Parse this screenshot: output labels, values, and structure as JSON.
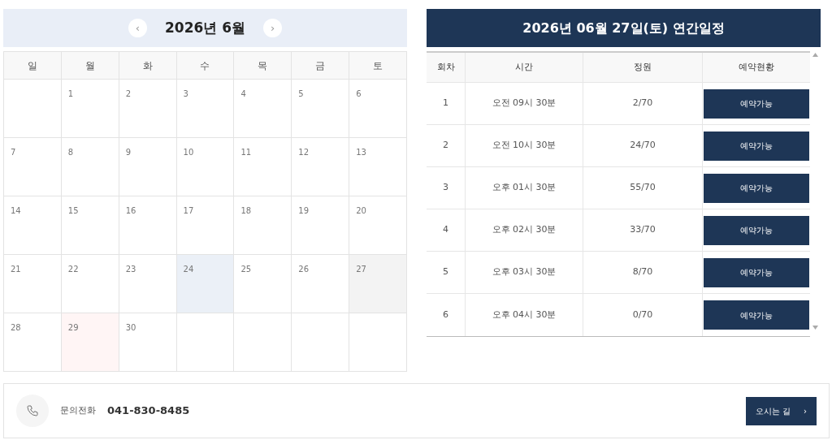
{
  "calendar": {
    "title": "2026년 6월",
    "prev": "‹",
    "next": "›",
    "weekdays": [
      "일",
      "월",
      "화",
      "수",
      "목",
      "금",
      "토"
    ],
    "days": [
      {
        "kind": "empty"
      },
      {
        "label": "1",
        "kind": "plain"
      },
      {
        "label": "2",
        "kind": "plain"
      },
      {
        "label": "3",
        "kind": "plain"
      },
      {
        "label": "4",
        "kind": "plain"
      },
      {
        "label": "5",
        "kind": "plain"
      },
      {
        "label": "6",
        "kind": "plain"
      },
      {
        "label": "7",
        "kind": "plain"
      },
      {
        "label": "8",
        "kind": "plain"
      },
      {
        "label": "9",
        "kind": "plain"
      },
      {
        "label": "10",
        "kind": "plain"
      },
      {
        "label": "11",
        "kind": "plain"
      },
      {
        "label": "12",
        "kind": "plain"
      },
      {
        "label": "13",
        "kind": "plain"
      },
      {
        "label": "14",
        "kind": "plain"
      },
      {
        "label": "15",
        "kind": "plain"
      },
      {
        "label": "16",
        "kind": "plain"
      },
      {
        "label": "17",
        "kind": "plain"
      },
      {
        "label": "18",
        "kind": "plain"
      },
      {
        "label": "19",
        "kind": "plain"
      },
      {
        "label": "20",
        "kind": "plain"
      },
      {
        "label": "21",
        "kind": "plain"
      },
      {
        "label": "22",
        "kind": "plain"
      },
      {
        "label": "23",
        "kind": "plain"
      },
      {
        "label": "24",
        "kind": "today"
      },
      {
        "label": "25",
        "kind": "plain"
      },
      {
        "label": "26",
        "kind": "plain"
      },
      {
        "label": "27",
        "kind": "selected"
      },
      {
        "label": "28",
        "kind": "plain"
      },
      {
        "label": "29",
        "kind": "holiday"
      },
      {
        "label": "30",
        "kind": "plain"
      },
      {
        "kind": "empty"
      },
      {
        "kind": "empty"
      },
      {
        "kind": "empty"
      },
      {
        "kind": "empty"
      }
    ]
  },
  "schedule": {
    "title": "2026년 06월 27일(토) 연간일정",
    "columns": [
      "회차",
      "시간",
      "정원",
      "예약현황"
    ],
    "rows": [
      {
        "round": "1",
        "time": "오전 09시 30분",
        "capacity": "2/70",
        "status": "예약가능"
      },
      {
        "round": "2",
        "time": "오전 10시 30분",
        "capacity": "24/70",
        "status": "예약가능"
      },
      {
        "round": "3",
        "time": "오후 01시 30분",
        "capacity": "55/70",
        "status": "예약가능"
      },
      {
        "round": "4",
        "time": "오후 02시 30분",
        "capacity": "33/70",
        "status": "예약가능"
      },
      {
        "round": "5",
        "time": "오후 03시 30분",
        "capacity": "8/70",
        "status": "예약가능"
      },
      {
        "round": "6",
        "time": "오후 04시 30분",
        "capacity": "0/70",
        "status": "예약가능"
      }
    ]
  },
  "footer": {
    "label": "문의전화",
    "phone": "041-830-8485",
    "button": "오시는 길",
    "button_arrow": "›"
  }
}
